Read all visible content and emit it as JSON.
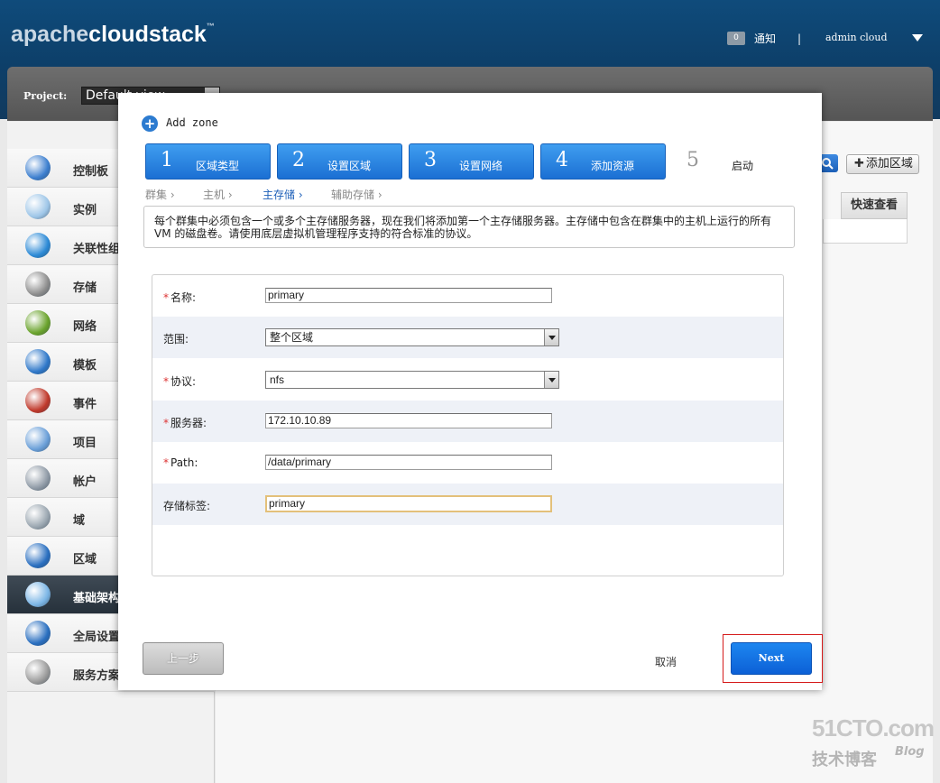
{
  "header": {
    "logo_prefix": "apache",
    "logo_main": "cloudstack",
    "logo_tm": "™",
    "notification_count": "0",
    "notification_label": "通知",
    "separator": "|",
    "user_name": "admin cloud"
  },
  "project": {
    "label": "Project:",
    "selected": "Default view"
  },
  "sidebar": {
    "items": [
      {
        "label": "控制板",
        "icon": "dashboard-icon",
        "color": "#3d7fcf"
      },
      {
        "label": "实例",
        "icon": "cloud-icon",
        "color": "#9ec6e8"
      },
      {
        "label": "关联性组",
        "icon": "affinity-icon",
        "color": "#2c8ad6"
      },
      {
        "label": "存储",
        "icon": "storage-icon",
        "color": "#8d8d8d"
      },
      {
        "label": "网络",
        "icon": "network-icon",
        "color": "#6aa32c"
      },
      {
        "label": "模板",
        "icon": "template-icon",
        "color": "#2f78c9"
      },
      {
        "label": "事件",
        "icon": "calendar-icon",
        "color": "#c0392b"
      },
      {
        "label": "项目",
        "icon": "folder-icon",
        "color": "#6a9fd8"
      },
      {
        "label": "帐户",
        "icon": "user-icon",
        "color": "#8f9aa6"
      },
      {
        "label": "域",
        "icon": "domain-icon",
        "color": "#9aa6b0"
      },
      {
        "label": "区域",
        "icon": "globe-icon",
        "color": "#2a6fc0"
      },
      {
        "label": "基础架构",
        "icon": "infrastructure-icon",
        "color": "#7cb6e6"
      },
      {
        "label": "全局设置",
        "icon": "global-settings-icon",
        "color": "#2a6fc0"
      },
      {
        "label": "服务方案",
        "icon": "gear-icon",
        "color": "#9a9a9a"
      }
    ]
  },
  "toolbar": {
    "add_zone_label": "添加区域",
    "quick_view_header": "快速查看"
  },
  "dialog": {
    "title": "Add zone",
    "steps": [
      {
        "num": "1",
        "label": "区域类型"
      },
      {
        "num": "2",
        "label": "设置区域"
      },
      {
        "num": "3",
        "label": "设置网络"
      },
      {
        "num": "4",
        "label": "添加资源"
      },
      {
        "num": "5",
        "label": "启动"
      }
    ],
    "substeps": [
      {
        "label": "群集 ›"
      },
      {
        "label": "主机 ›"
      },
      {
        "label": "主存储 ›"
      },
      {
        "label": "辅助存储 ›"
      }
    ],
    "description": "每个群集中必须包含一个或多个主存储服务器，现在我们将添加第一个主存储服务器。主存储中包含在群集中的主机上运行的所有 VM 的磁盘卷。请使用底层虚拟机管理程序支持的符合标准的协议。",
    "fields": {
      "name": {
        "label": "名称:",
        "value": "primary"
      },
      "scope": {
        "label": "范围:",
        "value": "整个区域"
      },
      "protocol": {
        "label": "协议:",
        "value": "nfs"
      },
      "server": {
        "label": "服务器:",
        "value": "172.10.10.89"
      },
      "path": {
        "label": "Path:",
        "value": "/data/primary"
      },
      "tags": {
        "label": "存储标签:",
        "value": "primary"
      }
    },
    "buttons": {
      "previous": "上一步",
      "cancel": "取消",
      "next": "Next"
    }
  },
  "watermark": {
    "site": "51CTO.com",
    "sub": "技术博客",
    "blog": "Blog"
  }
}
